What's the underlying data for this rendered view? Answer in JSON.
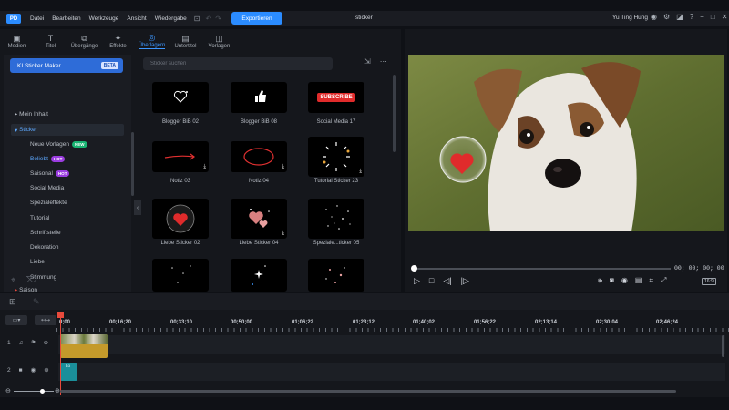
{
  "titlebar": {
    "logo_text": "PD",
    "menu": [
      "Datei",
      "Bearbeiten",
      "Werkzeuge",
      "Ansicht",
      "Wiedergabe"
    ],
    "export_label": "Exportieren",
    "doc_title": "sticker",
    "user": "Yu Ting Hung"
  },
  "tabs": [
    {
      "label": "Medien",
      "icon": "media-icon"
    },
    {
      "label": "Titel",
      "icon": "title-icon"
    },
    {
      "label": "Übergänge",
      "icon": "transition-icon"
    },
    {
      "label": "Effekte",
      "icon": "effects-icon"
    },
    {
      "label": "Überlagern",
      "icon": "overlay-icon",
      "active": true
    },
    {
      "label": "Untertitel",
      "icon": "subtitle-icon"
    },
    {
      "label": "Vorlagen",
      "icon": "template-icon"
    }
  ],
  "sidebar": {
    "ai_button": "KI Sticker Maker",
    "ai_badge": "BETA",
    "tree": [
      {
        "label": "Mein Inhalt",
        "arrow": "▸"
      },
      {
        "label": "Sticker",
        "arrow": "▾"
      }
    ],
    "subitems": [
      {
        "label": "Neue Vorlagen",
        "badge": "NEW"
      },
      {
        "label": "Beliebt",
        "badge": "HOT",
        "active": true
      },
      {
        "label": "Saisonal",
        "badge": "HOT"
      },
      {
        "label": "Social Media"
      },
      {
        "label": "Spezialeffekte"
      },
      {
        "label": "Tutorial"
      },
      {
        "label": "Schriftstelle"
      },
      {
        "label": "Dekoration"
      },
      {
        "label": "Liebe"
      },
      {
        "label": "Stimmung"
      }
    ],
    "saison": {
      "label": "Saison",
      "arrow": "▸"
    }
  },
  "search": {
    "placeholder": "Sticker suchen"
  },
  "cards": [
    {
      "label": "Blogger BiB 02"
    },
    {
      "label": "Blogger BiB 08"
    },
    {
      "label": "Social Media 17",
      "thumb_text": "SUBSCRIBE"
    },
    {
      "label": "Notiz 03"
    },
    {
      "label": "Notiz 04"
    },
    {
      "label": "Tutorial Sticker 23"
    },
    {
      "label": "Liebe Sticker 02"
    },
    {
      "label": "Liebe Sticker 04"
    },
    {
      "label": "Speziale...ticker 05"
    }
  ],
  "preview": {
    "timecode": "00; 00; 00; 00",
    "ratio": "16:9",
    "progress": 0
  },
  "timeline": {
    "ticks": [
      "0;00",
      "00;16;20",
      "00;33;10",
      "00;50;00",
      "01;06;22",
      "01;23;12",
      "01;40;02",
      "01;56;22",
      "02;13;14",
      "02;30;04",
      "02;46;24"
    ],
    "tracks": [
      {
        "number": "1"
      },
      {
        "number": "2"
      }
    ],
    "sticker_clip_label": "Lo"
  },
  "colors": {
    "accent": "#2b8cff",
    "badge_new": "#19b372",
    "badge_hot": "#9b3de0",
    "playhead": "#e84a3c",
    "video_clip": "#c49a2b",
    "sticker_clip": "#1b8f9a"
  }
}
